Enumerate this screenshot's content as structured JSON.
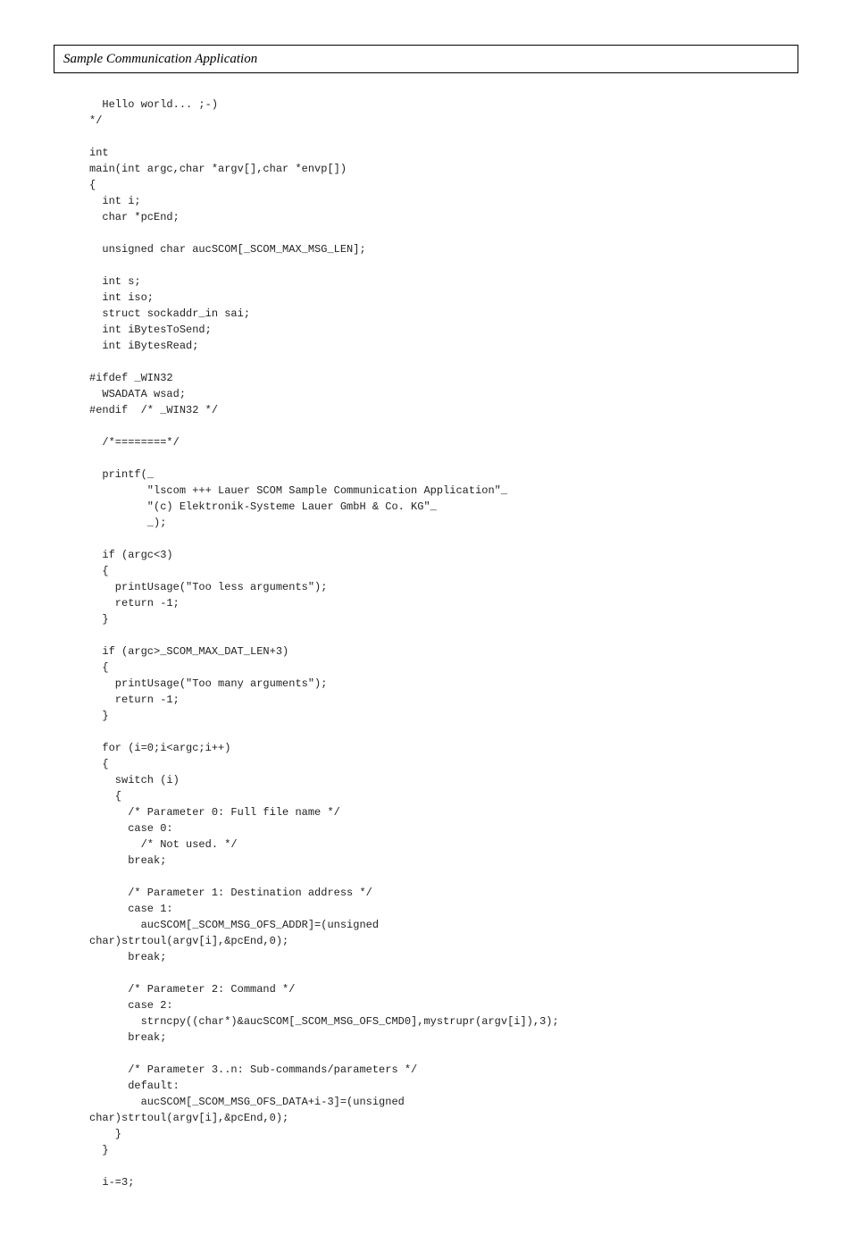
{
  "header": {
    "title": "Sample Communication Application"
  },
  "code": "  Hello world... ;-)\n*/\n\nint\nmain(int argc,char *argv[],char *envp[])\n{\n  int i;\n  char *pcEnd;\n\n  unsigned char aucSCOM[_SCOM_MAX_MSG_LEN];\n\n  int s;\n  int iso;\n  struct sockaddr_in sai;\n  int iBytesToSend;\n  int iBytesRead;\n\n#ifdef _WIN32\n  WSADATA wsad;\n#endif  /* _WIN32 */\n\n  /*========*/\n\n  printf(_\n         \"lscom +++ Lauer SCOM Sample Communication Application\"_\n         \"(c) Elektronik-Systeme Lauer GmbH & Co. KG\"_\n         _);\n\n  if (argc<3)\n  {\n    printUsage(\"Too less arguments\");\n    return -1;\n  }\n\n  if (argc>_SCOM_MAX_DAT_LEN+3)\n  {\n    printUsage(\"Too many arguments\");\n    return -1;\n  }\n\n  for (i=0;i<argc;i++)\n  {\n    switch (i)\n    {\n      /* Parameter 0: Full file name */\n      case 0:\n        /* Not used. */\n      break;\n\n      /* Parameter 1: Destination address */\n      case 1:\n        aucSCOM[_SCOM_MSG_OFS_ADDR]=(unsigned\nchar)strtoul(argv[i],&pcEnd,0);\n      break;\n\n      /* Parameter 2: Command */\n      case 2:\n        strncpy((char*)&aucSCOM[_SCOM_MSG_OFS_CMD0],mystrupr(argv[i]),3);\n      break;\n\n      /* Parameter 3..n: Sub-commands/parameters */\n      default:\n        aucSCOM[_SCOM_MSG_OFS_DATA+i-3]=(unsigned\nchar)strtoul(argv[i],&pcEnd,0);\n    }\n  }\n\n  i-=3;"
}
